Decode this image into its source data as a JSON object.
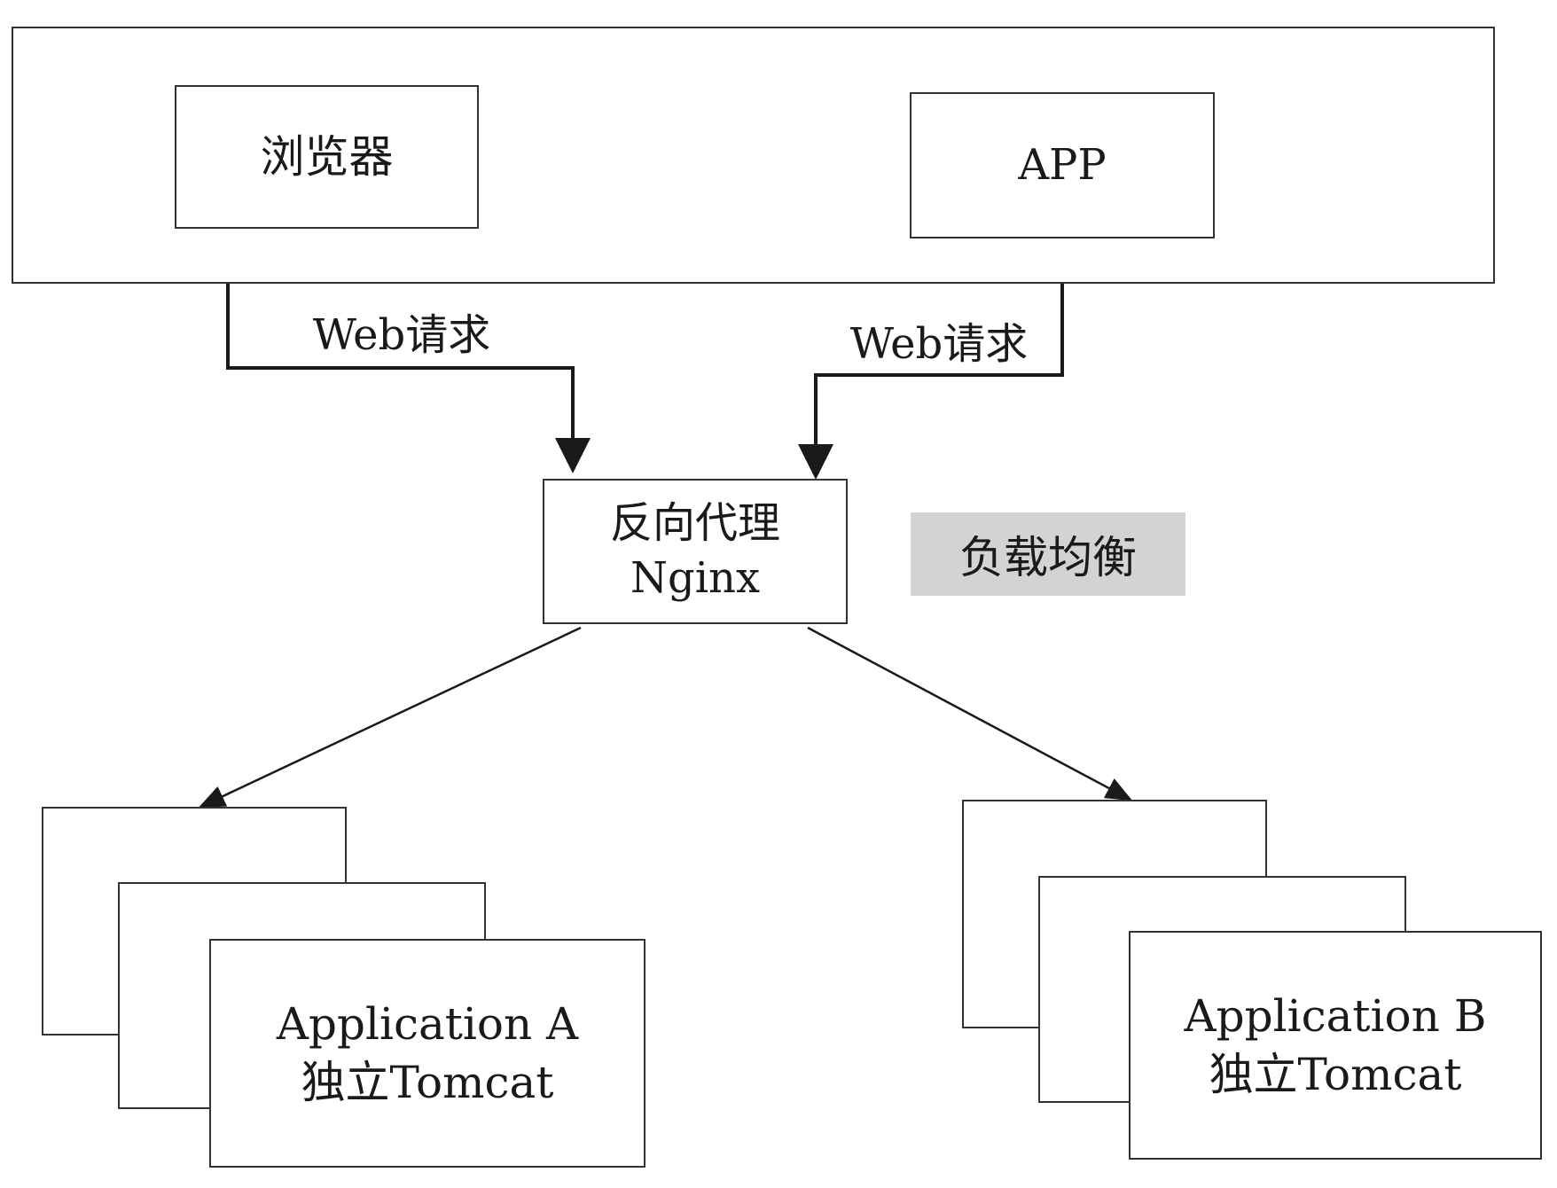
{
  "nodes": {
    "browser": "浏览器",
    "app": "APP",
    "nginx_line1": "反向代理",
    "nginx_line2": "Nginx",
    "load_balance": "负载均衡",
    "app_a_line1": "Application A",
    "app_a_line2": "独立Tomcat",
    "app_b_line1": "Application B",
    "app_b_line2": "独立Tomcat"
  },
  "edges": {
    "browser_to_nginx": "Web请求",
    "app_to_nginx": "Web请求"
  },
  "colors": {
    "stroke": "#333333",
    "highlight_fill": "#d3d3d3"
  }
}
